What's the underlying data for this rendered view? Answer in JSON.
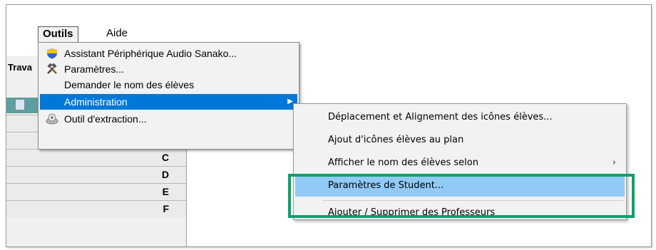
{
  "menubar": {
    "outils_label": "Outils",
    "aide_label": "Aide"
  },
  "left_panel": {
    "header_partial": "Trava",
    "rows": [
      "C",
      "D",
      "E",
      "F"
    ]
  },
  "outils_menu": {
    "items": [
      {
        "label": "Assistant Périphérique Audio Sanako...",
        "icon": "shield-icon"
      },
      {
        "label": "Paramètres...",
        "icon": "tools-icon"
      },
      {
        "label": "Demander le nom des élèves",
        "icon": ""
      },
      {
        "label": "Administration",
        "icon": "",
        "highlighted": true,
        "has_submenu": true
      },
      {
        "label": "Outil d'extraction...",
        "icon": "extraction-icon"
      }
    ]
  },
  "administration_submenu": {
    "items": [
      {
        "label": "Déplacement et Alignement des icônes élèves..."
      },
      {
        "label": "Ajout d'icônes élèves au plan"
      },
      {
        "label": "Afficher le nom des élèves selon",
        "has_submenu": true
      },
      {
        "label": "Paramètres de Student...",
        "hovered": true
      },
      {
        "label": "Ajouter / Supprimer des Professeurs"
      }
    ]
  },
  "colors": {
    "highlight_blue": "#0078d7",
    "hover_blue": "#91c9f7",
    "callout_green": "#0ea06a"
  },
  "annotations": {
    "callout_target": "Paramètres de Student..."
  }
}
